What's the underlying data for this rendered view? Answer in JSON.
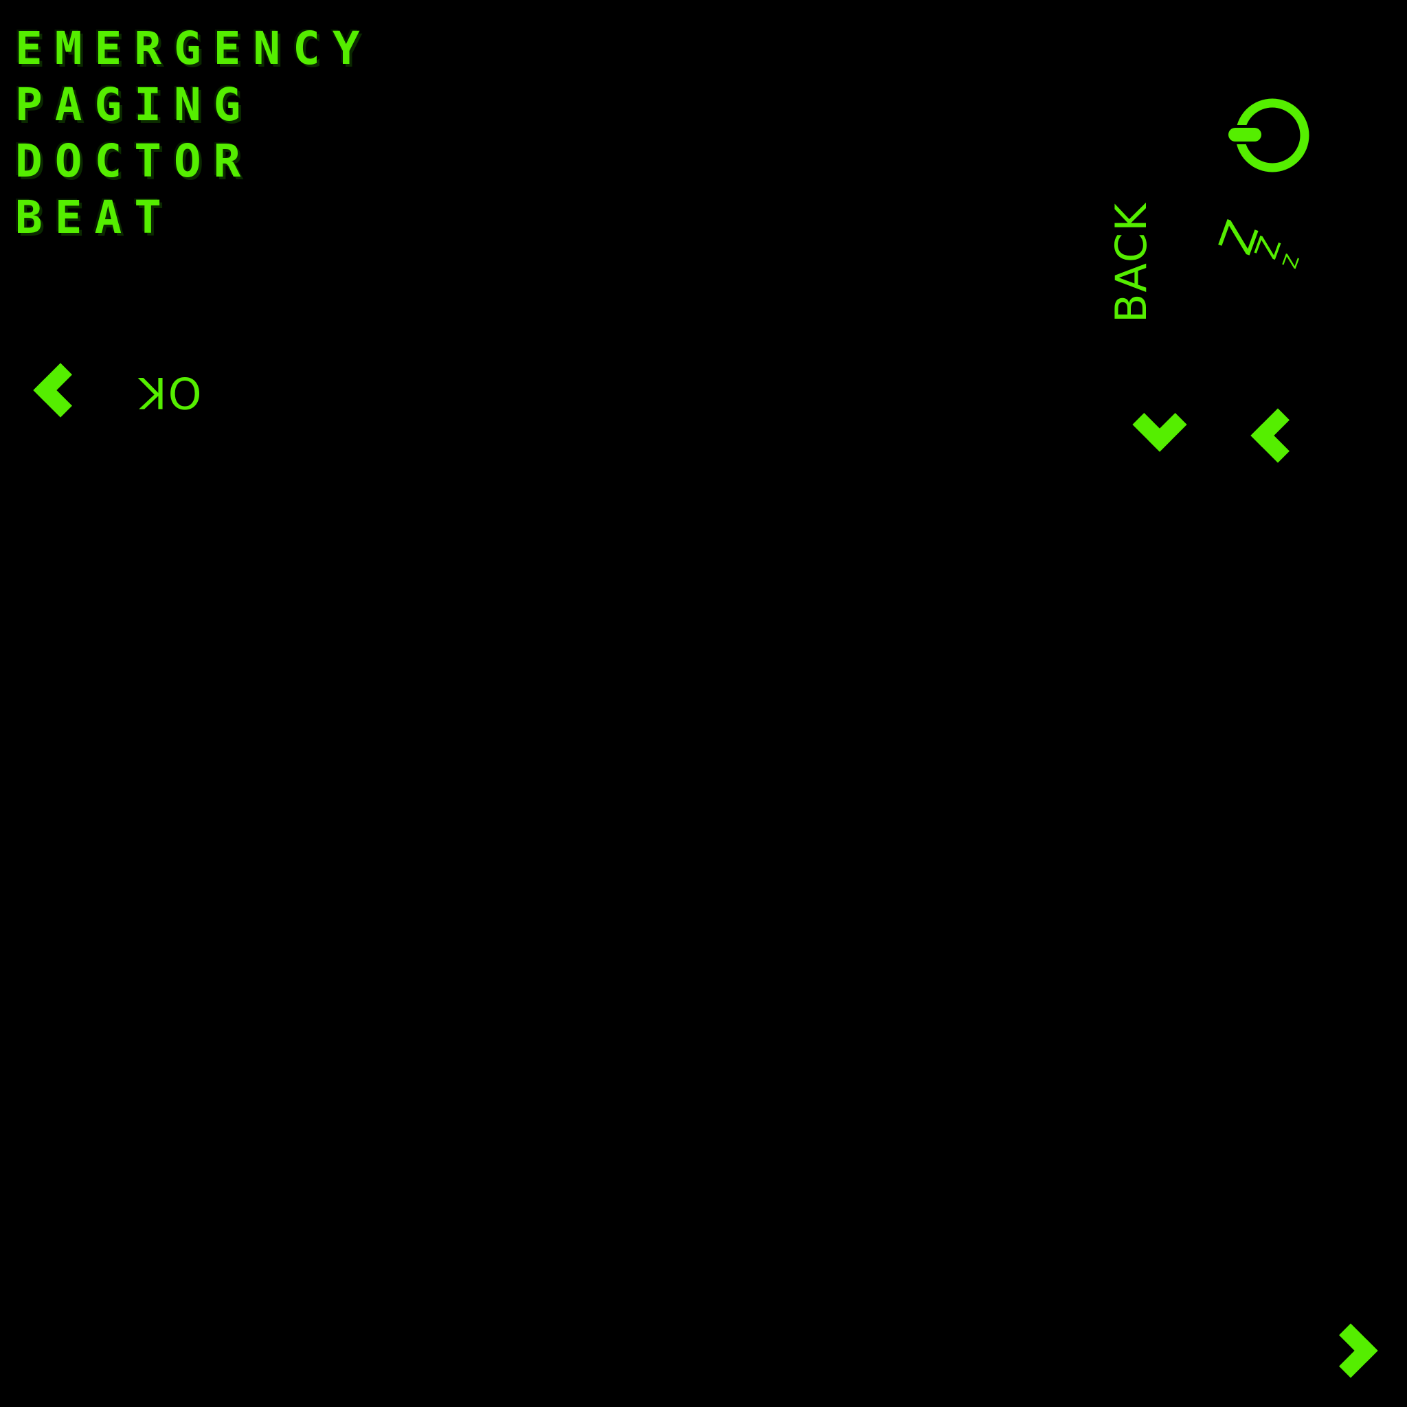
{
  "menu": {
    "items": [
      {
        "label": "EMERGENCY"
      },
      {
        "label": "PAGING"
      },
      {
        "label": "DOCTOR"
      },
      {
        "label": "BEAT"
      }
    ]
  },
  "controls": {
    "ok_label": "OK",
    "back_label": "BACK",
    "power_icon": "power-icon",
    "sleep_icon": "sleep-zzz-icon",
    "sleep_glyphs": [
      "Z",
      "Z",
      "Z"
    ]
  },
  "theme": {
    "background": "#000000",
    "accent": "#55ee00"
  }
}
